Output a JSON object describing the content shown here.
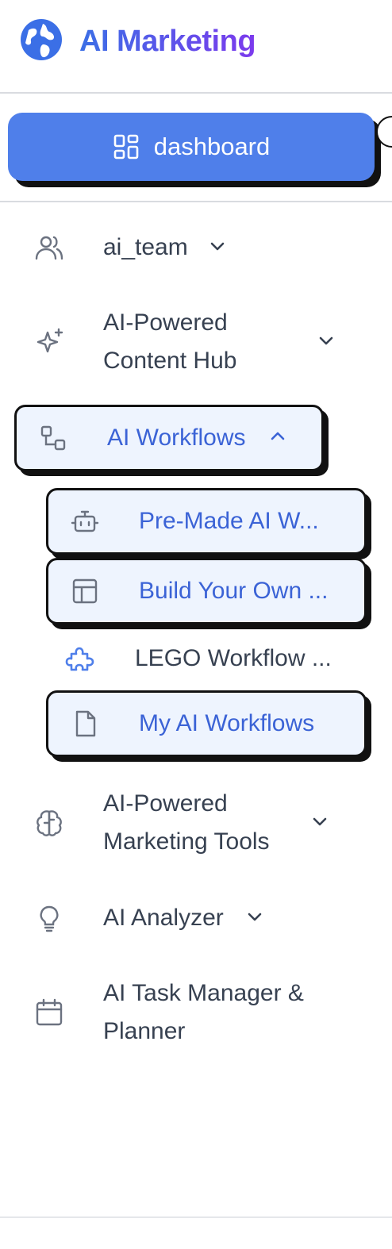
{
  "app": {
    "title": "AI Marketing"
  },
  "dashboard": {
    "label": "dashboard"
  },
  "nav": {
    "ai_team": "ai_team",
    "content_hub": {
      "line1": "AI-Powered",
      "line2": "Content Hub"
    },
    "workflows": "AI Workflows",
    "workflow_children": {
      "premade": "Pre-Made AI W...",
      "build_own": "Build Your Own ...",
      "lego": "LEGO Workflow ...",
      "my_workflows": "My AI Workflows"
    },
    "marketing_tools": {
      "line1": "AI-Powered",
      "line2": "Marketing Tools"
    },
    "analyzer": "AI Analyzer",
    "task_manager": {
      "line1": "AI Task Manager &",
      "line2": "Planner"
    }
  },
  "colors": {
    "accent": "#4f7fea",
    "active_text": "#3b63d6",
    "active_bg": "#eef4fe"
  }
}
